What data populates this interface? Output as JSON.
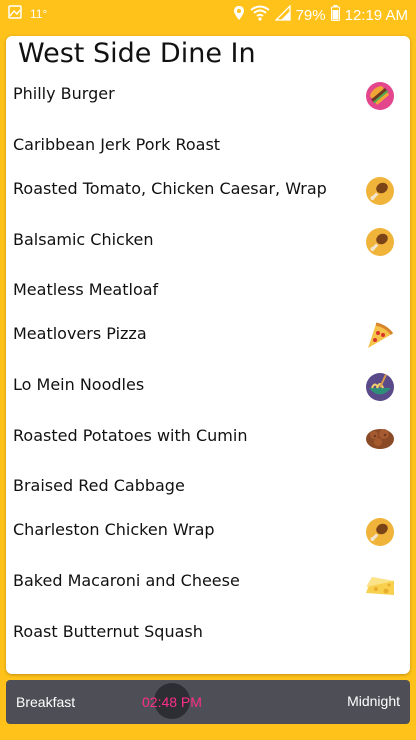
{
  "status_bar": {
    "notification_text": "11°",
    "battery": "79%",
    "time": "12:19 AM"
  },
  "page": {
    "title": "West Side Dine In"
  },
  "menu_items": [
    {
      "name": "Philly Burger",
      "icon": "burger-icon"
    },
    {
      "name": "Caribbean Jerk Pork Roast",
      "icon": ""
    },
    {
      "name": "Roasted Tomato, Chicken Caesar, Wrap",
      "icon": "chicken-leg-icon"
    },
    {
      "name": "Balsamic Chicken",
      "icon": "chicken-leg-icon"
    },
    {
      "name": "Meatless Meatloaf",
      "icon": ""
    },
    {
      "name": "Meatlovers Pizza",
      "icon": "pizza-icon"
    },
    {
      "name": "Lo Mein Noodles",
      "icon": "noodles-icon"
    },
    {
      "name": "Roasted Potatoes with Cumin",
      "icon": "potato-icon"
    },
    {
      "name": "Braised Red Cabbage",
      "icon": ""
    },
    {
      "name": "Charleston Chicken Wrap",
      "icon": "chicken-leg-icon"
    },
    {
      "name": "Baked Macaroni and Cheese",
      "icon": "cheese-icon"
    },
    {
      "name": "Roast Butternut Squash",
      "icon": ""
    }
  ],
  "time_slider": {
    "start_label": "Breakfast",
    "end_label": "Midnight",
    "current_time": "02:48 PM",
    "accent_color": "#ff2d8a"
  }
}
